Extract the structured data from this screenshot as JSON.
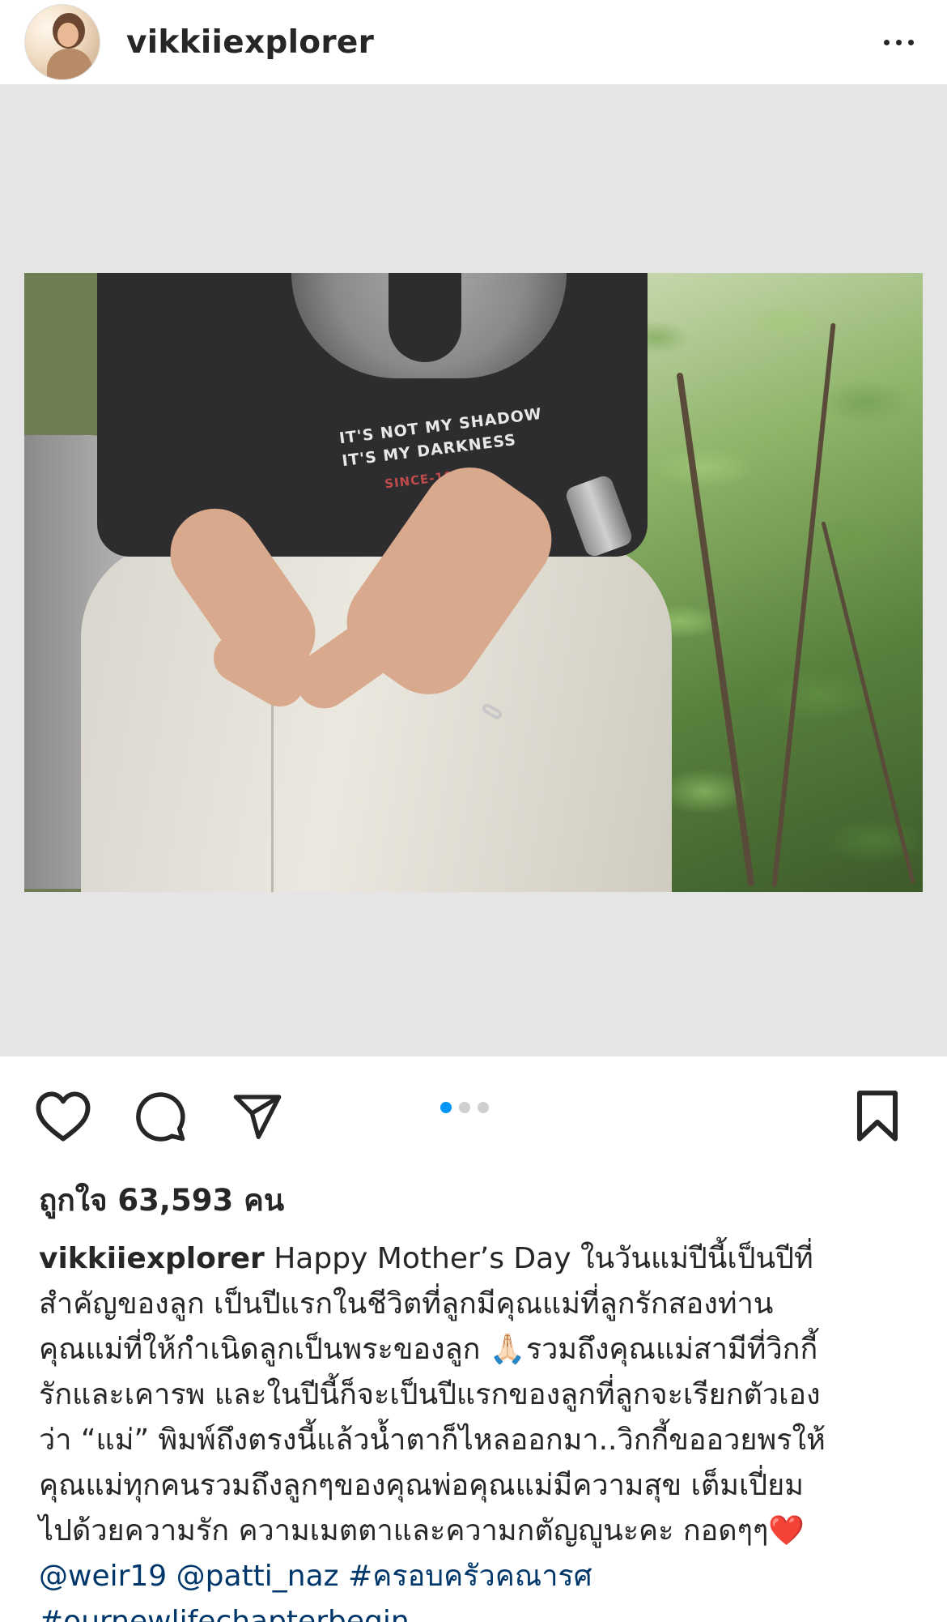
{
  "post": {
    "username": "vikkiiexplorer"
  },
  "media": {
    "shirt_line1": "IT'S NOT MY SHADOW",
    "shirt_line2": "IT'S MY DARKNESS",
    "shirt_since": "SINCE-1980",
    "carousel_count": 3,
    "carousel_active": 1
  },
  "likes": {
    "text": "ถูกใจ 63,593 คน"
  },
  "caption": {
    "username": "vikkiiexplorer",
    "line1": " Happy Mother’s Day ในวันแม่ปีนี้เป็นปีที่",
    "line2": "สำคัญของลูก เป็นปีแรกในชีวิตที่ลูกมีคุณแม่ที่ลูกรักสองท่าน",
    "line3_a": "คุณแม่ที่ให้กำเนิดลูกเป็นพระของลูก ",
    "line3_emoji": "🙏🏻",
    "line3_b": "รวมถึงคุณแม่สามีที่วิกกี้",
    "line4": "รักและเคารพ และในปีนี้ก็จะเป็นปีแรกของลูกที่ลูกจะเรียกตัวเอง",
    "line5": "ว่า “แม่” พิมพ์ถึงตรงนี้แล้วน้ำตาก็ไหลออกมา..วิกกี้ขออวยพรให้",
    "line6": "คุณแม่ทุกคนรวมถึงลูกๆของคุณพ่อคุณแม่มีความสุข เต็มเปี่ยม",
    "line7": "ไปด้วยความรัก ความเมตตาและความกตัญญูนะคะ กอดๆๆ",
    "line7_emoji": "❤️",
    "mention1": "@weir19",
    "mention2": "@patti_naz",
    "hashtag1": "#ครอบครัวคณารศ",
    "hashtag2": "#ournewlifechapterbegin"
  },
  "icons": {
    "like": "heart-outline-icon",
    "comment": "comment-bubble-icon",
    "share": "paper-plane-icon",
    "save": "bookmark-icon",
    "more": "more-horizontal-icon"
  },
  "colors": {
    "link": "#00376b",
    "active_dot": "#0095f6",
    "media_bg": "#e5e5e5"
  }
}
